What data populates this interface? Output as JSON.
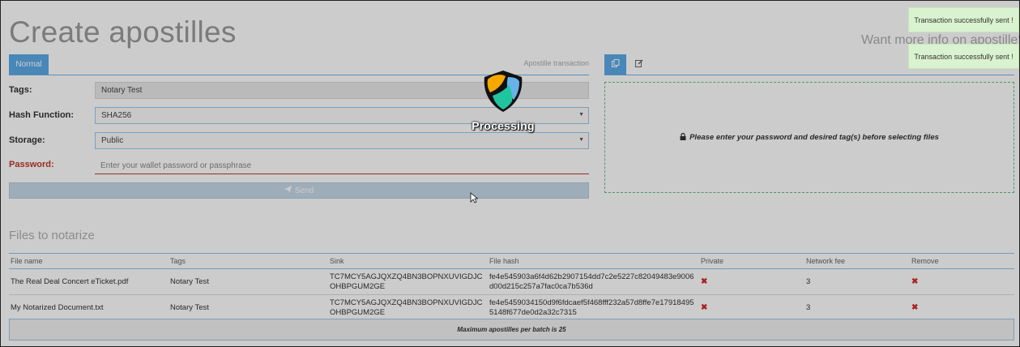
{
  "page": {
    "title": "Create apostilles",
    "more_info": "Want more info on apostille?"
  },
  "form": {
    "tab_normal": "Normal",
    "tab_apostille": "Apostille transaction",
    "tags_label": "Tags:",
    "tags_value": "Notary Test",
    "hash_label": "Hash Function:",
    "hash_value": "SHA256",
    "storage_label": "Storage:",
    "storage_value": "Public",
    "password_label": "Password:",
    "password_placeholder": "Enter your wallet password or passphrase",
    "send_label": "Send"
  },
  "upload": {
    "message": "Please enter your password and desired tag(s) before selecting files"
  },
  "files": {
    "section_title": "Files to notarize",
    "columns": [
      "File name",
      "Tags",
      "Sink",
      "File hash",
      "Private",
      "Network fee",
      "Remove"
    ],
    "rows": [
      {
        "file_name": "The Real Deal Concert eTicket.pdf",
        "tags": "Notary Test",
        "sink": "TC7MCY5AGJQXZQ4BN3BOPNXUVIGDJCOHBPGUM2GE",
        "hash": "fe4e545903a6f4d62b2907154dd7c2e5227c82049483e9006d00d215c257a7fac0ca7b536d",
        "private": "✖",
        "fee": "3",
        "remove": "✖"
      },
      {
        "file_name": "My Notarized Document.txt",
        "tags": "Notary Test",
        "sink": "TC7MCY5AGJQXZQ4BN3BOPNXUVIGDJCOHBPGUM2GE",
        "hash": "fe4e5459034150d9f6fdcaef5f468fff232a57d8ffe7e179184955148f677de0d2a32c7315",
        "private": "✖",
        "fee": "3",
        "remove": "✖"
      }
    ],
    "batch_note": "Maximum apostilles per batch is 25"
  },
  "notifications": [
    "Transaction successfully sent !",
    "Transaction successfully sent !"
  ],
  "overlay": {
    "label": "Processing"
  },
  "colors": {
    "accent": "#5aa9e6",
    "error": "#c0392b",
    "success_bg": "#d9f2cf",
    "dropzone_border": "#5fbf85",
    "logo_orange": "#f7a800",
    "logo_blue": "#67b2e8",
    "logo_teal": "#20c5a0"
  },
  "icons": {
    "send": "paper-plane-icon",
    "lock": "lock-icon",
    "upload_tab": "copy-icon",
    "edit_tab": "edit-icon",
    "logo": "nem-logo-icon",
    "cursor": "mouse-cursor-icon"
  }
}
